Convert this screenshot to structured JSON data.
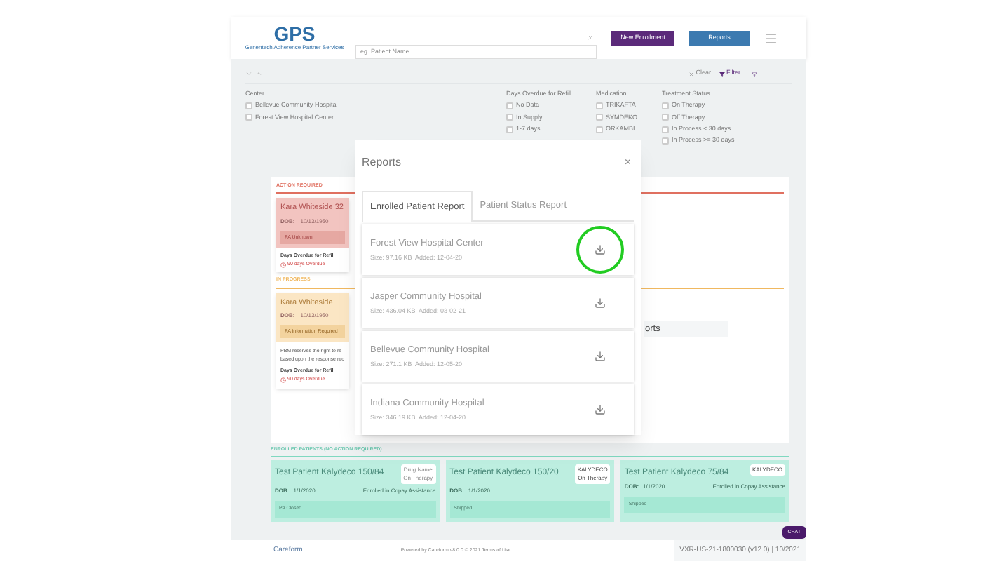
{
  "header": {
    "logo": "GPS",
    "logo_tagline": "Genentech Adherence Partner Services",
    "search": {
      "placeholder": "eg. Patient Name"
    },
    "buttons": [
      {
        "label": "New Enrollment",
        "kind": "primary"
      },
      {
        "label": "Reports",
        "kind": "secondary"
      }
    ]
  },
  "toolbar": {
    "clear": "Clear",
    "filter": "Filter"
  },
  "filters": [
    {
      "title": "Center",
      "options": [
        {
          "label": "Bellevue Community Hospital",
          "checked": false
        },
        {
          "label": "Forest View Hospital Center",
          "checked": false
        }
      ]
    },
    {
      "title": "Days Overdue for Refill",
      "options": [
        {
          "label": "No Data",
          "checked": false
        },
        {
          "label": "In Supply",
          "checked": false
        },
        {
          "label": "1-7 days",
          "checked": false
        }
      ]
    },
    {
      "title": "Medication",
      "options": [
        {
          "label": "TRIKAFTA",
          "checked": false
        },
        {
          "label": "SYMDEKO",
          "checked": false
        },
        {
          "label": "ORKAMBI",
          "checked": false
        }
      ]
    },
    {
      "title": "Treatment Status",
      "options": [
        {
          "label": "On Therapy",
          "checked": false
        },
        {
          "label": "Off Therapy",
          "checked": false
        },
        {
          "label": "In Process < 30 days",
          "checked": false
        },
        {
          "label": "In Process >= 30 days",
          "checked": false
        }
      ]
    }
  ],
  "sections": [
    {
      "heading": "ACTION REQUIRED",
      "color": "#e07060",
      "card": {
        "name": "Kara Whiteside 32",
        "dob_label": "DOB:",
        "dob": "10/13/1950",
        "status": "PA Unknown",
        "overdue_label": "Days Overdue for Refill",
        "overdue": "90 days Overdue"
      }
    },
    {
      "heading": "IN PROGRESS",
      "color": "#f0b860",
      "card": {
        "name": "Kara Whiteside",
        "dob_label": "DOB:",
        "dob": "10/13/1950",
        "status": "PA Information Required",
        "note": "PBM reserves the right to re based upon the response rec",
        "overdue_label": "Days Overdue for Refill",
        "overdue": "90 days Overdue"
      },
      "side_text": "orts"
    }
  ],
  "enrolled": {
    "heading": "ENROLLED PATIENTS (NO ACTION REQUIRED)",
    "cards": [
      {
        "name": "Test Patient Kalydeco 150/84",
        "dob_label": "DOB:",
        "dob": "1/1/2020",
        "enrolled": "Enrolled in Copay Assistance",
        "badge": [
          "Drug Name",
          "On Therapy"
        ],
        "badge_disabled": true,
        "status": "PA Closed"
      },
      {
        "name": "Test Patient Kalydeco 150/20",
        "dob_label": "DOB:",
        "dob": "1/1/2020",
        "badge": [
          "KALYDECO",
          "On Therapy"
        ],
        "badge_disabled": false,
        "status": "Shipped"
      },
      {
        "name": "Test Patient Kalydeco 75/84",
        "dob_label": "DOB:",
        "dob": "1/1/2020",
        "enrolled": "Enrolled in Copay Assistance",
        "badge": [
          "KALYDECO"
        ],
        "badge_disabled": false,
        "status": "Shipped"
      }
    ]
  },
  "footer": {
    "logo": "Careform",
    "powered": "Powered by Careform v8.0.0 © 2021 Terms of Use",
    "version": "VXR-US-21-1800030 (v12.0) | 10/2021",
    "chat": "CHAT"
  },
  "modal": {
    "title": "Reports",
    "close": "×",
    "tabs": [
      {
        "label": "Enrolled Patient Report",
        "selected": true
      },
      {
        "label": "Patient Status Report",
        "selected": false
      }
    ],
    "reports": [
      {
        "name": "Forest View Hospital Center",
        "meta": "Size: 97.16 KB  Added: 12-04-20",
        "highlighted": true
      },
      {
        "name": "Jasper Community Hospital",
        "meta": "Size: 436.04 KB  Added: 03-02-21",
        "highlighted": false
      },
      {
        "name": "Bellevue Community Hospital",
        "meta": "Size: 271.1 KB  Added: 12-05-20",
        "highlighted": false
      },
      {
        "name": "Indiana Community Hospital",
        "meta": "Size: 346.19 KB  Added: 12-04-20",
        "highlighted": false
      }
    ]
  }
}
